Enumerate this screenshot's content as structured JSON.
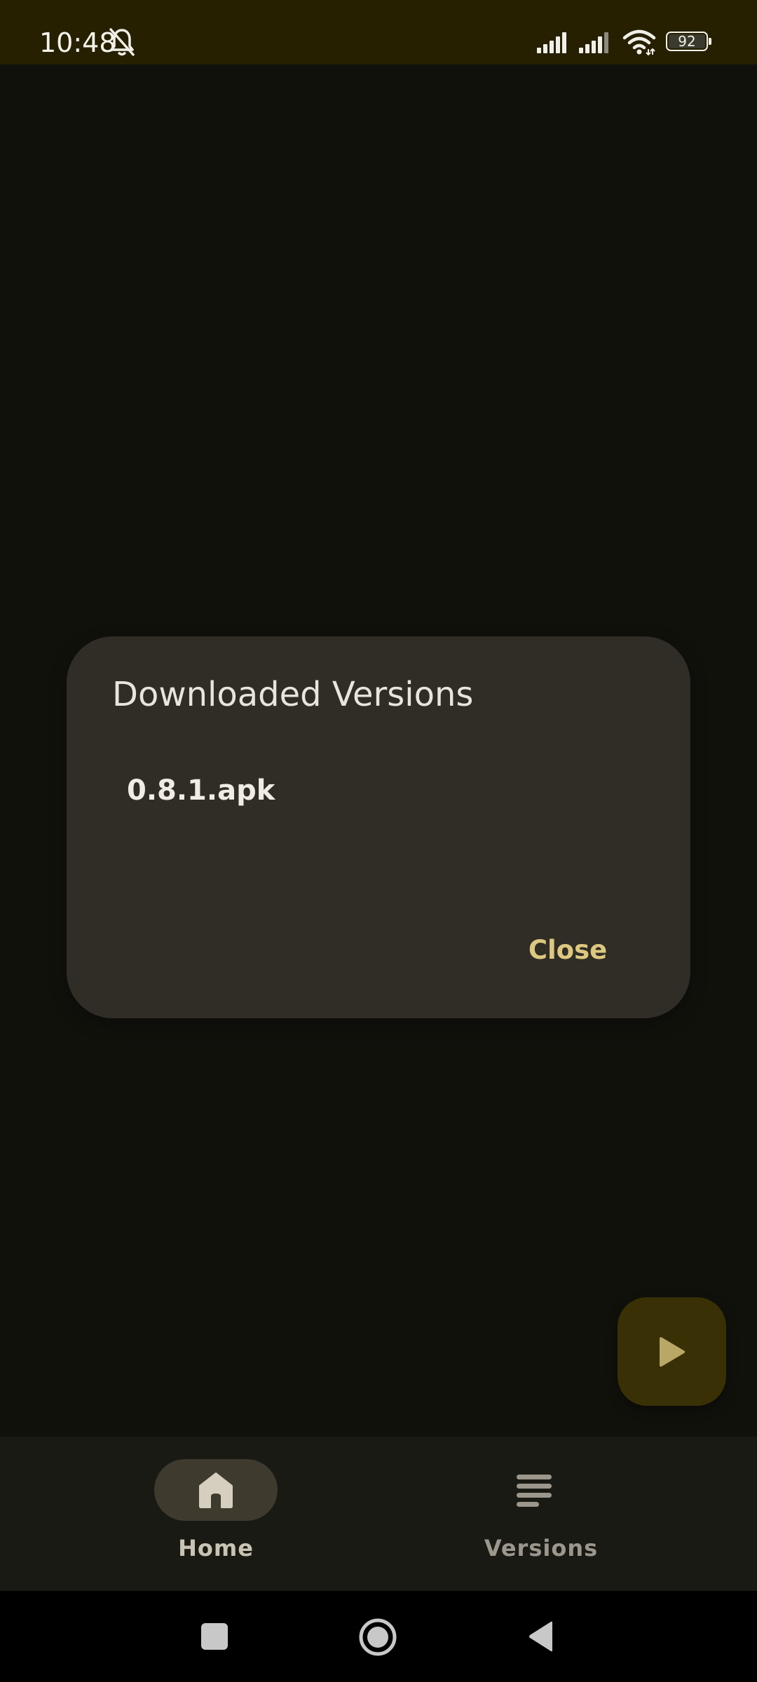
{
  "status_bar": {
    "time": "10:48",
    "battery_level": "92",
    "icons": [
      "bell-off-icon",
      "signal-1-icon",
      "signal-2-icon",
      "wifi-icon",
      "battery-icon"
    ]
  },
  "dialog": {
    "title": "Downloaded Versions",
    "items": [
      "0.8.1.apk"
    ],
    "close_label": "Close"
  },
  "fab": {
    "icon": "play-icon"
  },
  "bottom_nav": {
    "items": [
      {
        "label": "Home",
        "icon": "home-icon",
        "selected": true
      },
      {
        "label": "Versions",
        "icon": "list-icon",
        "selected": false
      }
    ]
  },
  "system_nav": {
    "icons": [
      "recents-icon",
      "home-circle-icon",
      "back-icon"
    ]
  },
  "colors": {
    "background": "#11110c",
    "status_bar": "#262000",
    "dialog": "#302c26",
    "accent": "#ddc87f",
    "fab": "#3a3006"
  }
}
